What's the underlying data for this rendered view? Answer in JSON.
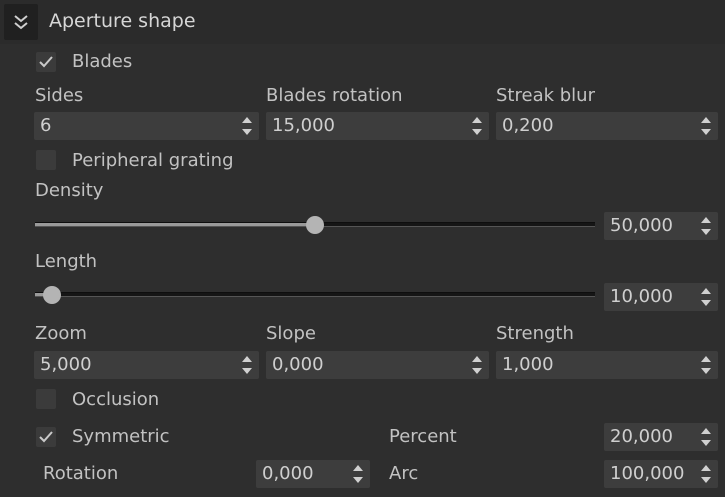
{
  "header": {
    "title": "Aperture shape"
  },
  "blades": {
    "checkbox_label": "Blades",
    "checked": true,
    "fields": [
      {
        "label": "Sides",
        "value": "6"
      },
      {
        "label": "Blades rotation",
        "value": "15,000"
      },
      {
        "label": "Streak blur",
        "value": "0,200"
      }
    ]
  },
  "peripheral": {
    "checkbox_label": "Peripheral grating",
    "checked": false
  },
  "density": {
    "label": "Density",
    "value": "50,000",
    "fraction": 0.5
  },
  "length": {
    "label": "Length",
    "value": "10,000",
    "fraction": 0.03
  },
  "zoom_row": {
    "fields": [
      {
        "label": "Zoom",
        "value": "5,000"
      },
      {
        "label": "Slope",
        "value": "0,000"
      },
      {
        "label": "Strength",
        "value": "1,000"
      }
    ]
  },
  "occlusion": {
    "checkbox_label": "Occlusion",
    "checked": false
  },
  "symmetric": {
    "checkbox_label": "Symmetric",
    "checked": true
  },
  "percent": {
    "label": "Percent",
    "value": "20,000"
  },
  "rotation": {
    "label": "Rotation",
    "value": "0,000"
  },
  "arc": {
    "label": "Arc",
    "value": "100,000"
  },
  "icons": {
    "collapse": "double-chevron-down-icon",
    "check": "checkmark-icon",
    "spin": "spin-arrows-icon"
  }
}
